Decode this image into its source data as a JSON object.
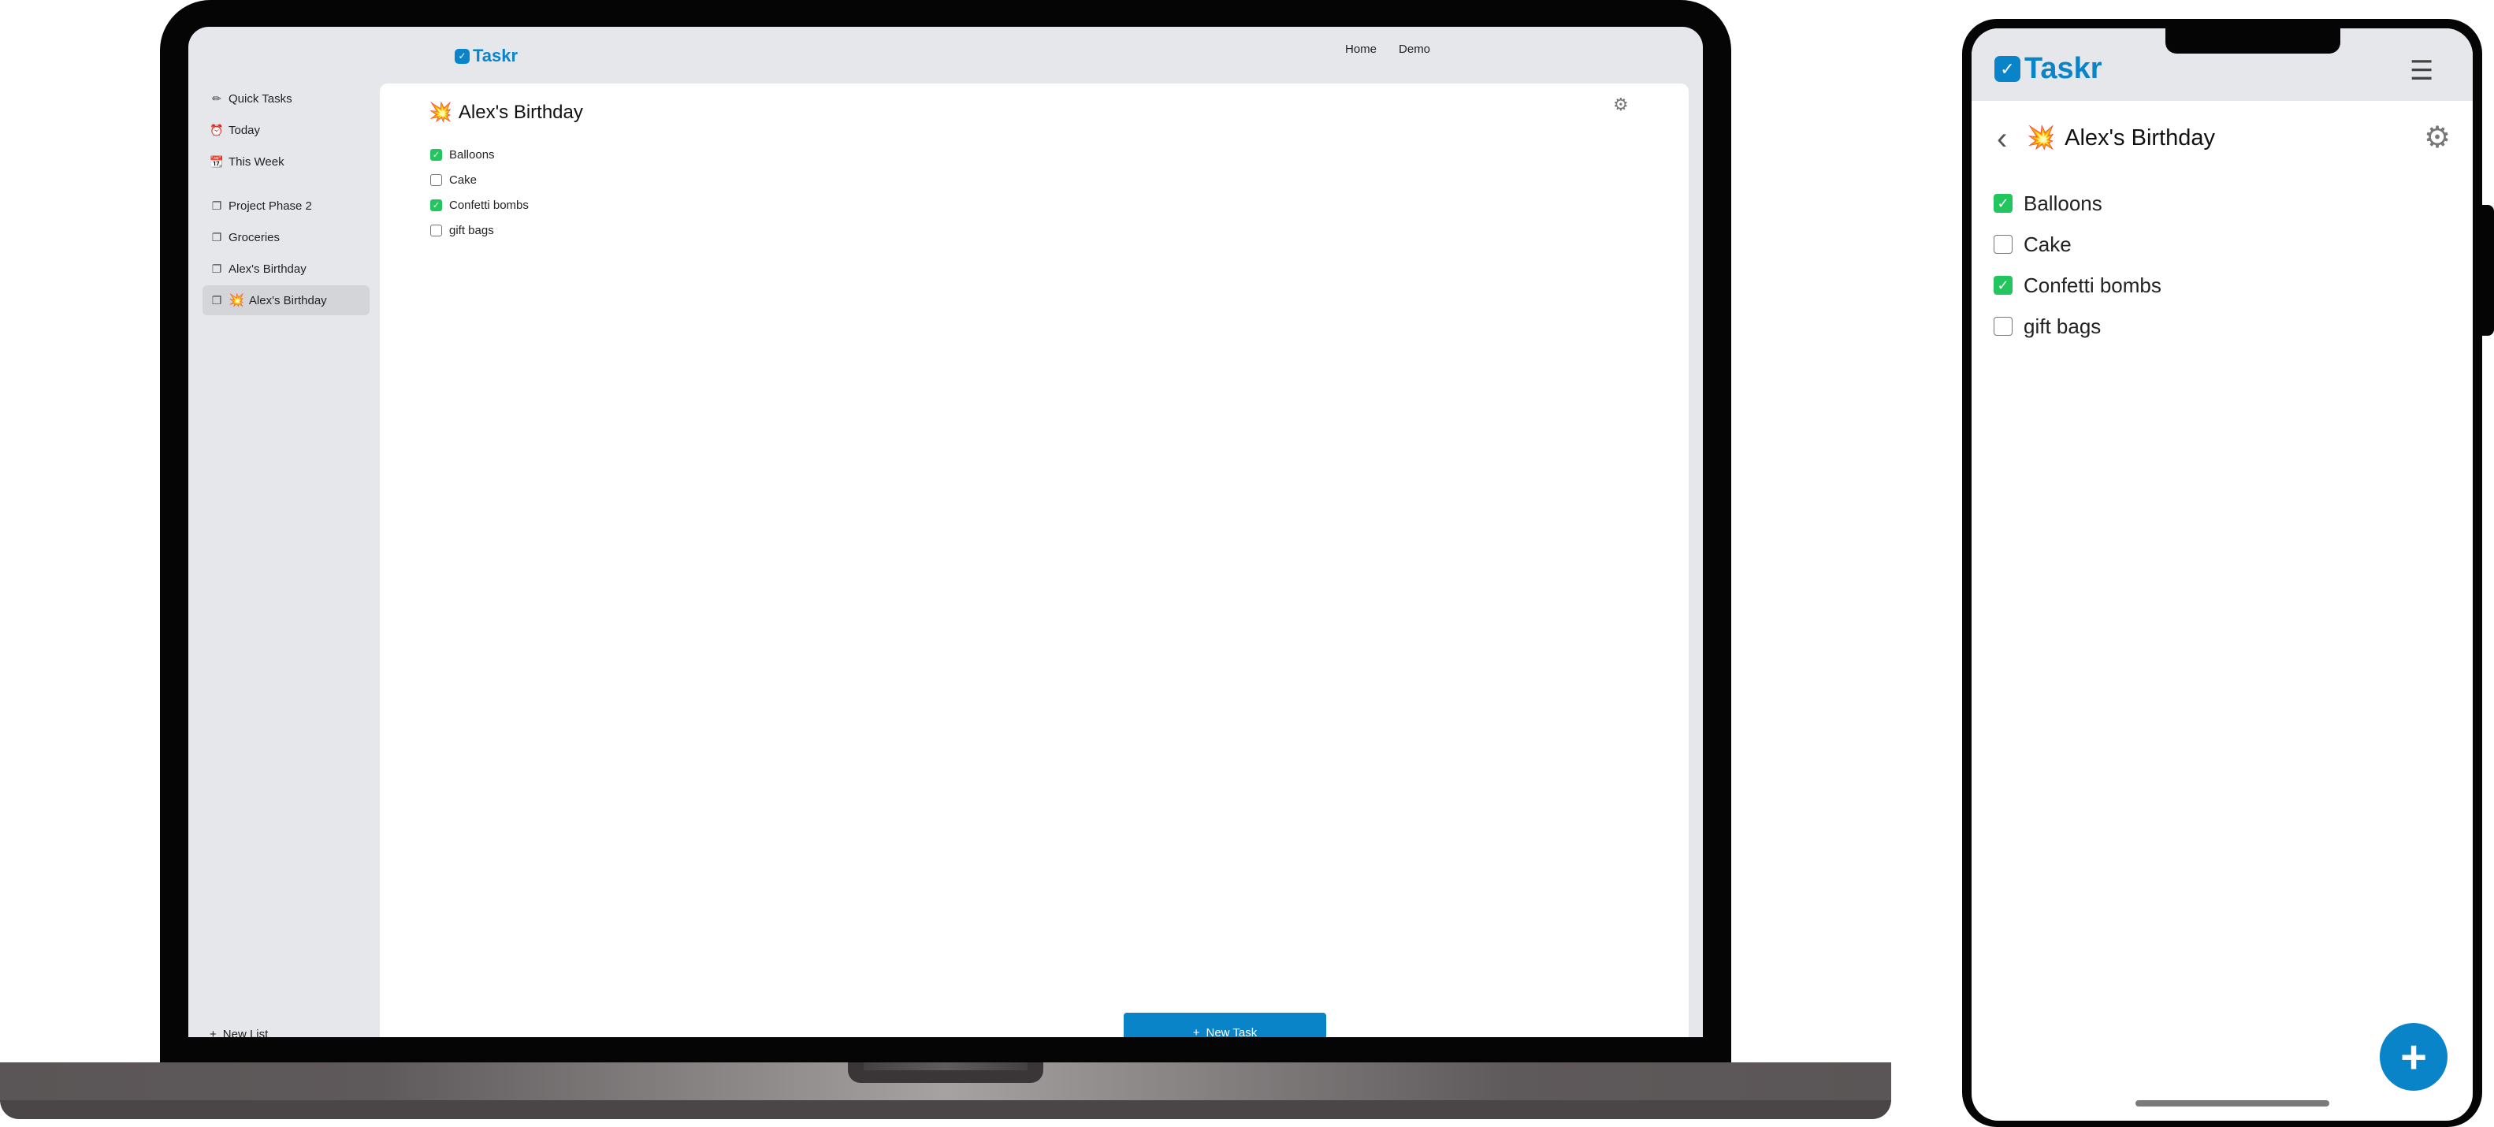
{
  "app": {
    "name": "Taskr",
    "logo_mark": "✓"
  },
  "desktop": {
    "nav": [
      "Home",
      "Demo"
    ],
    "sidebar": {
      "items": [
        {
          "label": "Quick Tasks",
          "icon": "pencil-icon",
          "glyph": "✏"
        },
        {
          "label": "Today",
          "icon": "alarm-clock-icon",
          "glyph": "⏰"
        },
        {
          "label": "This Week",
          "icon": "calendar-icon",
          "glyph": "📆"
        },
        {
          "label": "Project Phase 2",
          "icon": "list-icon",
          "glyph": "❐"
        },
        {
          "label": "Groceries",
          "icon": "list-icon",
          "glyph": "❐"
        },
        {
          "label": "Alex's Birthday",
          "icon": "list-icon",
          "glyph": "❐"
        },
        {
          "label": "Alex's Birthday",
          "icon": "list-icon",
          "glyph": "❐",
          "emoji": "💥",
          "active": true
        }
      ],
      "new_list": "New List"
    },
    "new_task": "New Task"
  },
  "list": {
    "title": "Alex's Birthday",
    "emoji": "💥",
    "tasks": [
      {
        "label": "Balloons",
        "checked": true
      },
      {
        "label": "Cake",
        "checked": false
      },
      {
        "label": "Confetti bombs",
        "checked": true
      },
      {
        "label": "gift bags",
        "checked": false
      }
    ]
  },
  "mobile": {
    "fab_label": "+"
  },
  "colors": {
    "accent": "#0a84c9",
    "checked": "#22c55e",
    "chrome": "#e5e7eb",
    "active_item": "#d3d5d9"
  }
}
